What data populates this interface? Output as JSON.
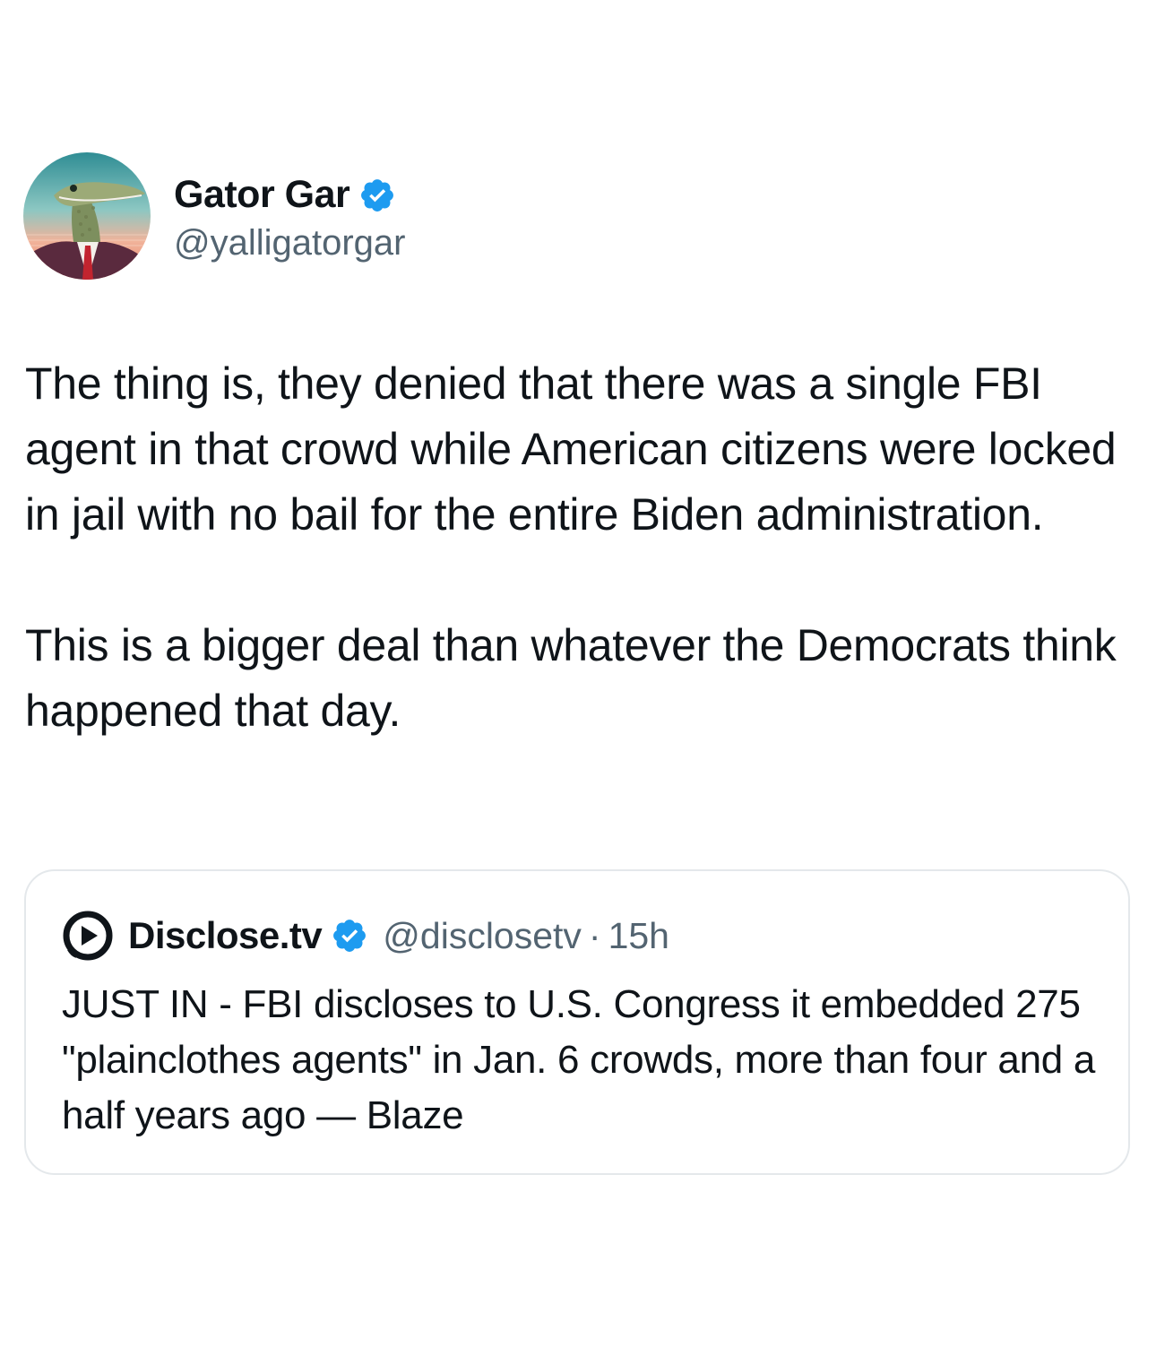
{
  "author": {
    "display_name": "Gator Gar",
    "handle": "@yalligatorgar",
    "verified": true,
    "avatar_icon": "alligator-in-suit-avatar"
  },
  "tweet": {
    "paragraphs": [
      "The thing is, they denied that there was a single FBI agent in that crowd while American citizens were locked in jail with no bail for the entire Biden administration.",
      "This is a bigger deal than whatever the Democrats think happened that day."
    ]
  },
  "quoted_tweet": {
    "logo_icon": "disclose-tv-logo-icon",
    "display_name": "Disclose.tv",
    "verified": true,
    "handle": "@disclosetv",
    "separator": "·",
    "time": "15h",
    "text": "JUST IN - FBI discloses to U.S. Congress it embedded 275 \"plainclothes agents\" in Jan. 6 crowds, more than four and a half years ago — Blaze"
  },
  "colors": {
    "text_primary": "#0f1419",
    "text_secondary": "#536471",
    "verified_blue": "#1d9bf0",
    "card_border": "#e4e8eb"
  }
}
